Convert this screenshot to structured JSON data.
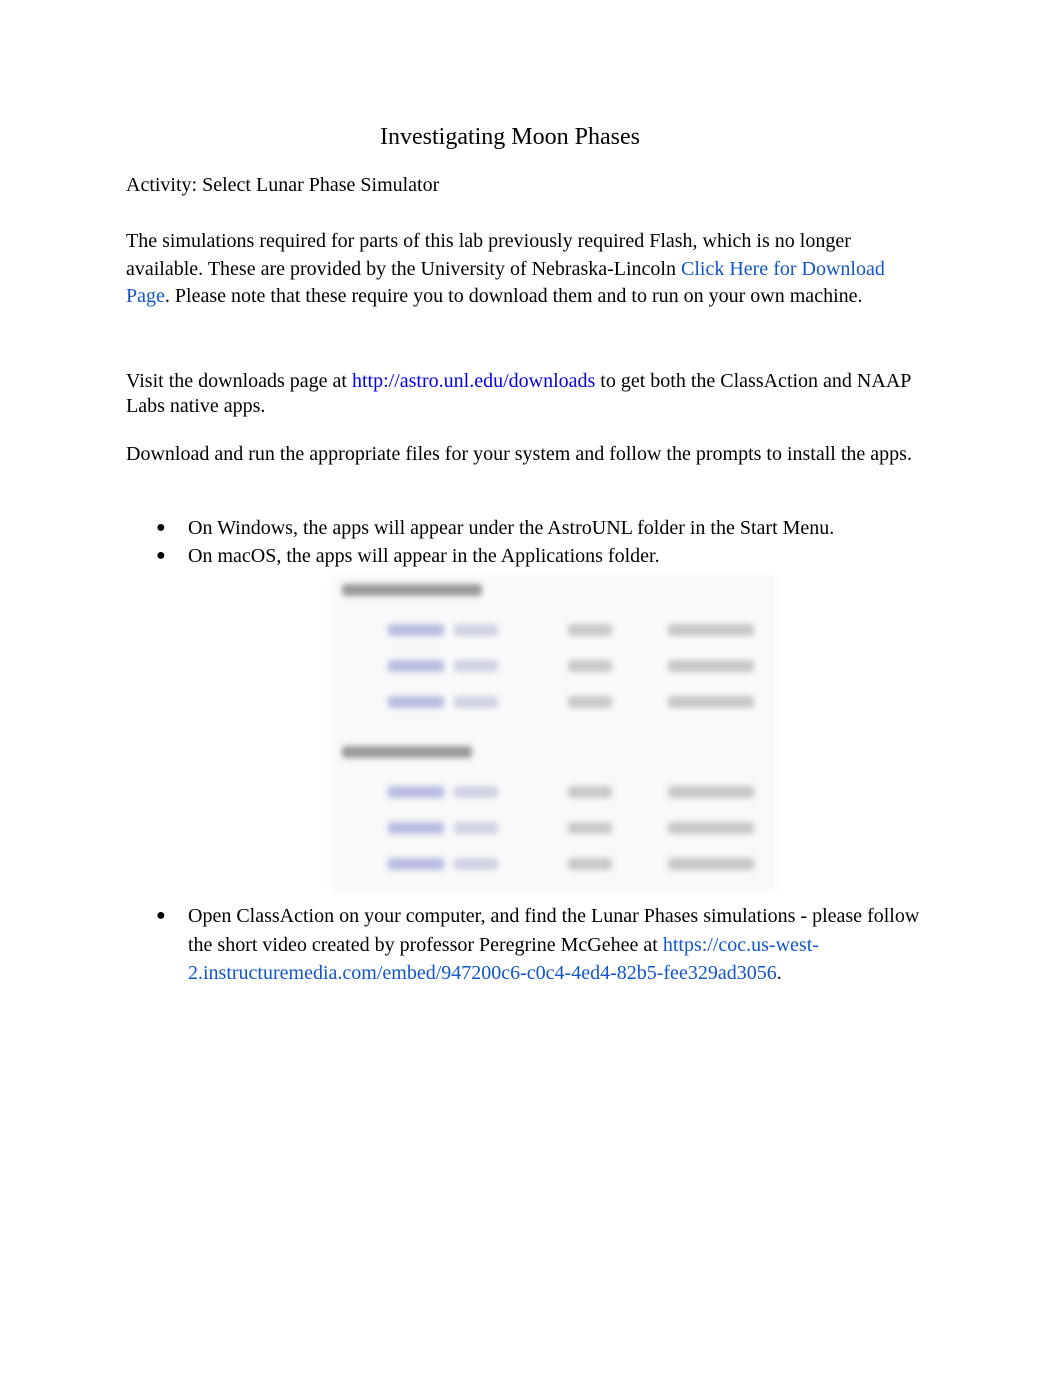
{
  "document": {
    "title": "Investigating Moon Phases",
    "activity": "Activity: Select Lunar Phase Simulator",
    "paragraph1": {
      "text_before_link": "The simulations required for parts of this lab previously required Flash, which is no longer available. These are provided by the University of Nebraska-Lincoln ",
      "link_text": "Click Here for Download Page",
      "text_after_link": ". Please note that these require you to download them and to run on your own machine."
    },
    "paragraph2": {
      "text_before_link": "Visit the downloads page at ",
      "link_text": "http://astro.unl.edu/downloads",
      "text_after_link": " to get both the ClassAction and NAAP Labs native apps."
    },
    "paragraph3": "Download and run the appropriate files for your system and follow the prompts to install the apps.",
    "bullets_install": [
      "On Windows, the apps will appear under the AstroUNL folder in the Start Menu.",
      "On macOS, the apps will appear in the Applications folder."
    ],
    "bullet_glyph": "●",
    "embedded_image": {
      "description": "blurred screenshot of download table",
      "sections": 2,
      "rows_per_section": 3,
      "legible": false
    },
    "bullet_open": {
      "text_before_link": "Open ClassAction on your computer, and find the Lunar Phases simulations -  please follow the short video created by professor Peregrine McGehee  at ",
      "link_text": "https://coc.us-west-2.instructuremedia.com/embed/947200c6-c0c4-4ed4-82b5-fee329ad3056",
      "text_after_link": "."
    },
    "colors": {
      "link": "#1155cc",
      "link_plain": "#0000ee",
      "text": "#000000"
    }
  }
}
